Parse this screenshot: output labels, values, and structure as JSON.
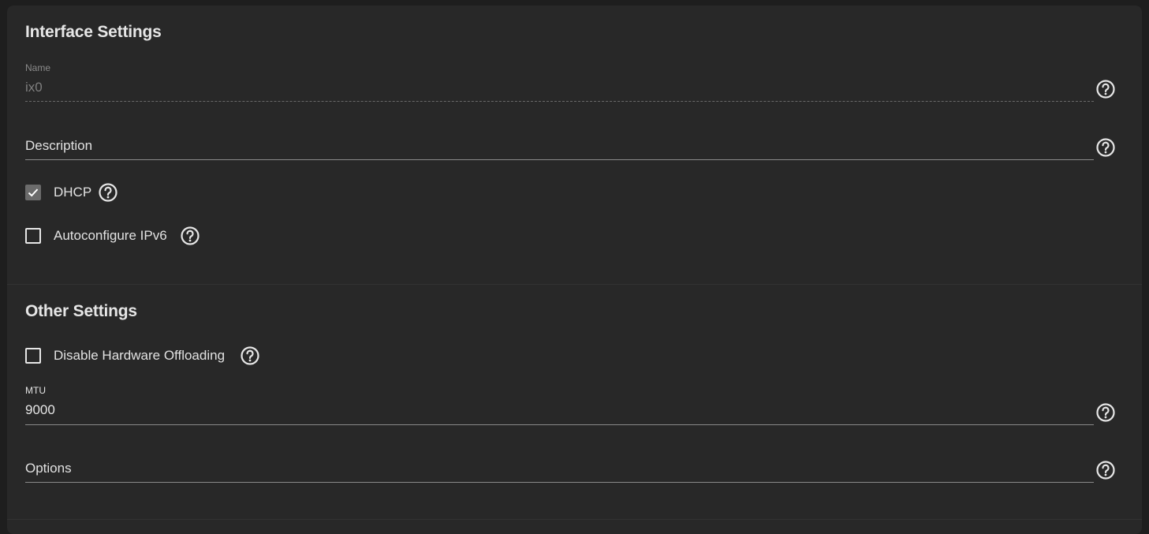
{
  "interface_settings": {
    "title": "Interface Settings",
    "name_field": {
      "label": "Name",
      "value": "ix0",
      "disabled": true
    },
    "description_field": {
      "placeholder": "Description",
      "value": ""
    },
    "dhcp": {
      "label": "DHCP",
      "checked": true
    },
    "autoconfigure_ipv6": {
      "label": "Autoconfigure IPv6",
      "checked": false
    }
  },
  "other_settings": {
    "title": "Other Settings",
    "disable_hw_offloading": {
      "label": "Disable Hardware Offloading",
      "checked": false
    },
    "mtu_field": {
      "label": "MTU",
      "value": "9000"
    },
    "options_field": {
      "placeholder": "Options",
      "value": ""
    }
  },
  "icons": {
    "help": "help-circle-icon",
    "check": "check-icon"
  },
  "colors": {
    "background": "#1e1e1e",
    "card": "#282828",
    "text": "#e6e6e6",
    "muted_text": "#8a8a8a",
    "checkbox_checked": "#6b6b6b"
  }
}
